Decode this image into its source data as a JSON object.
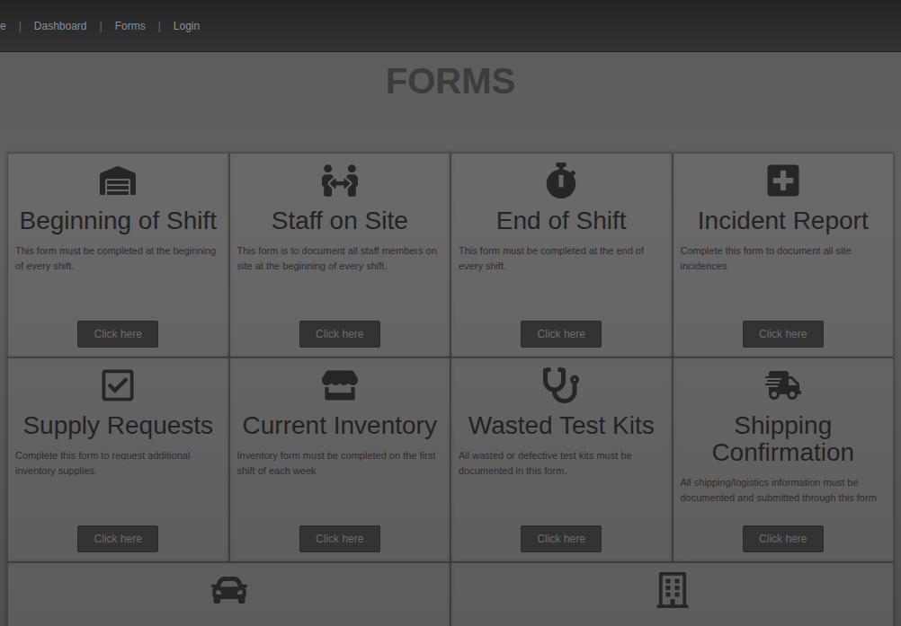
{
  "nav": {
    "links": [
      {
        "label": "e"
      },
      {
        "label": "Dashboard"
      },
      {
        "label": "Forms"
      },
      {
        "label": "Login"
      }
    ],
    "separator": "|"
  },
  "page": {
    "title": "FORMS"
  },
  "cards": [
    {
      "kind": "full",
      "title": "Beginning of Shift",
      "description": "This form must be completed at the beginning of every shift.",
      "button": "Click here"
    },
    {
      "kind": "full",
      "title": "Staff on Site",
      "description": "This form is to document all staff members on site at the beginning of every shift.",
      "button": "Click here"
    },
    {
      "kind": "full",
      "title": "End of Shift",
      "description": "This form must be completed at the end of every shift.",
      "button": "Click here"
    },
    {
      "kind": "full",
      "title": "Incident Report",
      "description": "Complete this form to document all site incidences",
      "button": "Click here"
    },
    {
      "kind": "full",
      "title": "Supply Requests",
      "description": "Complete this form to request additional inventory supplies.",
      "button": "Click here"
    },
    {
      "kind": "full",
      "title": "Current Inventory",
      "description": "Inventory form must be completed on the first shift of each week",
      "button": "Click here"
    },
    {
      "kind": "full",
      "title": "Wasted Test Kits",
      "description": "All wasted or defective test kits must be documented in this form.",
      "button": "Click here"
    },
    {
      "kind": "full",
      "title": "Shipping Confirmation",
      "description": "All shipping/logistics information must be documented and submitted through this form",
      "button": "Click here"
    },
    {
      "kind": "partial"
    },
    {
      "kind": "partial"
    }
  ]
}
